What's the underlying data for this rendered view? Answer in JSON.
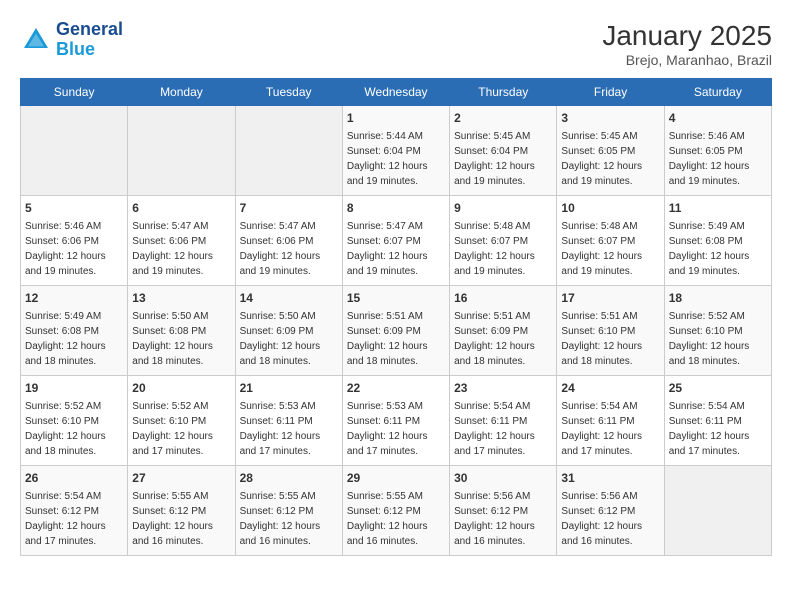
{
  "logo": {
    "line1": "General",
    "line2": "Blue"
  },
  "title": "January 2025",
  "subtitle": "Brejo, Maranhao, Brazil",
  "weekdays": [
    "Sunday",
    "Monday",
    "Tuesday",
    "Wednesday",
    "Thursday",
    "Friday",
    "Saturday"
  ],
  "weeks": [
    [
      {
        "day": "",
        "info": ""
      },
      {
        "day": "",
        "info": ""
      },
      {
        "day": "",
        "info": ""
      },
      {
        "day": "1",
        "info": "Sunrise: 5:44 AM\nSunset: 6:04 PM\nDaylight: 12 hours and 19 minutes."
      },
      {
        "day": "2",
        "info": "Sunrise: 5:45 AM\nSunset: 6:04 PM\nDaylight: 12 hours and 19 minutes."
      },
      {
        "day": "3",
        "info": "Sunrise: 5:45 AM\nSunset: 6:05 PM\nDaylight: 12 hours and 19 minutes."
      },
      {
        "day": "4",
        "info": "Sunrise: 5:46 AM\nSunset: 6:05 PM\nDaylight: 12 hours and 19 minutes."
      }
    ],
    [
      {
        "day": "5",
        "info": "Sunrise: 5:46 AM\nSunset: 6:06 PM\nDaylight: 12 hours and 19 minutes."
      },
      {
        "day": "6",
        "info": "Sunrise: 5:47 AM\nSunset: 6:06 PM\nDaylight: 12 hours and 19 minutes."
      },
      {
        "day": "7",
        "info": "Sunrise: 5:47 AM\nSunset: 6:06 PM\nDaylight: 12 hours and 19 minutes."
      },
      {
        "day": "8",
        "info": "Sunrise: 5:47 AM\nSunset: 6:07 PM\nDaylight: 12 hours and 19 minutes."
      },
      {
        "day": "9",
        "info": "Sunrise: 5:48 AM\nSunset: 6:07 PM\nDaylight: 12 hours and 19 minutes."
      },
      {
        "day": "10",
        "info": "Sunrise: 5:48 AM\nSunset: 6:07 PM\nDaylight: 12 hours and 19 minutes."
      },
      {
        "day": "11",
        "info": "Sunrise: 5:49 AM\nSunset: 6:08 PM\nDaylight: 12 hours and 19 minutes."
      }
    ],
    [
      {
        "day": "12",
        "info": "Sunrise: 5:49 AM\nSunset: 6:08 PM\nDaylight: 12 hours and 18 minutes."
      },
      {
        "day": "13",
        "info": "Sunrise: 5:50 AM\nSunset: 6:08 PM\nDaylight: 12 hours and 18 minutes."
      },
      {
        "day": "14",
        "info": "Sunrise: 5:50 AM\nSunset: 6:09 PM\nDaylight: 12 hours and 18 minutes."
      },
      {
        "day": "15",
        "info": "Sunrise: 5:51 AM\nSunset: 6:09 PM\nDaylight: 12 hours and 18 minutes."
      },
      {
        "day": "16",
        "info": "Sunrise: 5:51 AM\nSunset: 6:09 PM\nDaylight: 12 hours and 18 minutes."
      },
      {
        "day": "17",
        "info": "Sunrise: 5:51 AM\nSunset: 6:10 PM\nDaylight: 12 hours and 18 minutes."
      },
      {
        "day": "18",
        "info": "Sunrise: 5:52 AM\nSunset: 6:10 PM\nDaylight: 12 hours and 18 minutes."
      }
    ],
    [
      {
        "day": "19",
        "info": "Sunrise: 5:52 AM\nSunset: 6:10 PM\nDaylight: 12 hours and 18 minutes."
      },
      {
        "day": "20",
        "info": "Sunrise: 5:52 AM\nSunset: 6:10 PM\nDaylight: 12 hours and 17 minutes."
      },
      {
        "day": "21",
        "info": "Sunrise: 5:53 AM\nSunset: 6:11 PM\nDaylight: 12 hours and 17 minutes."
      },
      {
        "day": "22",
        "info": "Sunrise: 5:53 AM\nSunset: 6:11 PM\nDaylight: 12 hours and 17 minutes."
      },
      {
        "day": "23",
        "info": "Sunrise: 5:54 AM\nSunset: 6:11 PM\nDaylight: 12 hours and 17 minutes."
      },
      {
        "day": "24",
        "info": "Sunrise: 5:54 AM\nSunset: 6:11 PM\nDaylight: 12 hours and 17 minutes."
      },
      {
        "day": "25",
        "info": "Sunrise: 5:54 AM\nSunset: 6:11 PM\nDaylight: 12 hours and 17 minutes."
      }
    ],
    [
      {
        "day": "26",
        "info": "Sunrise: 5:54 AM\nSunset: 6:12 PM\nDaylight: 12 hours and 17 minutes."
      },
      {
        "day": "27",
        "info": "Sunrise: 5:55 AM\nSunset: 6:12 PM\nDaylight: 12 hours and 16 minutes."
      },
      {
        "day": "28",
        "info": "Sunrise: 5:55 AM\nSunset: 6:12 PM\nDaylight: 12 hours and 16 minutes."
      },
      {
        "day": "29",
        "info": "Sunrise: 5:55 AM\nSunset: 6:12 PM\nDaylight: 12 hours and 16 minutes."
      },
      {
        "day": "30",
        "info": "Sunrise: 5:56 AM\nSunset: 6:12 PM\nDaylight: 12 hours and 16 minutes."
      },
      {
        "day": "31",
        "info": "Sunrise: 5:56 AM\nSunset: 6:12 PM\nDaylight: 12 hours and 16 minutes."
      },
      {
        "day": "",
        "info": ""
      }
    ]
  ]
}
